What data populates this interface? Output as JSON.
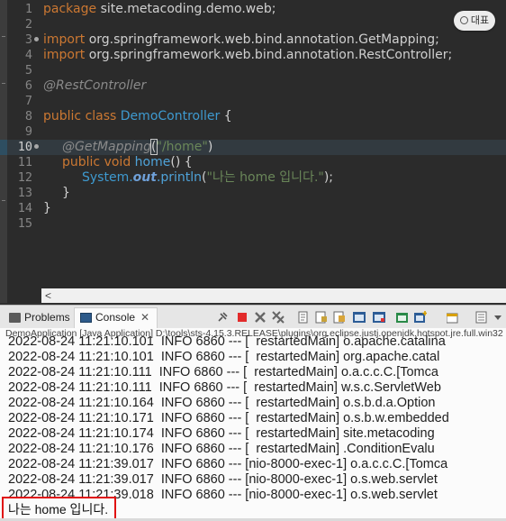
{
  "editor": {
    "translate_button": "대표",
    "line_numbers": [
      "1",
      "2",
      "3",
      "4",
      "5",
      "6",
      "7",
      "8",
      "9",
      "10",
      "11",
      "12",
      "13",
      "14",
      "15"
    ],
    "lines": {
      "l1_kw": "package ",
      "l1_rest": "site.metacoding.demo.web;",
      "l3_kw": "import ",
      "l3_rest": "org.springframework.web.bind.annotation.GetMapping;",
      "l4_kw": "import ",
      "l4_rest": "org.springframework.web.bind.annotation.RestController;",
      "l6_ann": "@RestController",
      "l8_kw": "public class ",
      "l8_type": "DemoController",
      "l8_rest": " {",
      "l10_ann": "@GetMapping",
      "l10_paren": "(",
      "l10_str": "\"/home\"",
      "l10_close": ")",
      "l11_kw": "public void ",
      "l11_mth": "home",
      "l11_rest": "() {",
      "l12_cls": "System.",
      "l12_fld": "out",
      "l12_mth": ".println",
      "l12_paren": "(",
      "l12_str": "\"나는 home 입니다.\"",
      "l12_rest": ");",
      "l13": "}",
      "l14": "}"
    },
    "scroll_arrow": "<"
  },
  "views": {
    "problems_tab": "Problems",
    "console_tab": "Console",
    "close_symbol": "✕",
    "toolbar_icons": [
      "pin-icon",
      "terminate-icon",
      "remove-launch-icon",
      "remove-all-icon",
      "clear-console-icon",
      "scroll-lock-icon",
      "word-wrap-icon",
      "show-on-stdout-icon",
      "show-on-stderr-icon",
      "open-console-icon",
      "new-console-icon",
      "display-selected-icon"
    ]
  },
  "console": {
    "launch_label": "DemoApplication [Java Application] D:\\tools\\sts-4.15.3.RELEASE\\plugins\\org.eclipse.justj.openjdk.hotspot.jre.full.win32",
    "log_lines": [
      "2022-08-24 11:21:10.101  INFO 6860 --- [  restartedMain] o.apache.catalina",
      "2022-08-24 11:21:10.101  INFO 6860 --- [  restartedMain] org.apache.catal",
      "2022-08-24 11:21:10.111  INFO 6860 --- [  restartedMain] o.a.c.c.C.[Tomca",
      "2022-08-24 11:21:10.111  INFO 6860 --- [  restartedMain] w.s.c.ServletWeb",
      "2022-08-24 11:21:10.164  INFO 6860 --- [  restartedMain] o.s.b.d.a.Option",
      "2022-08-24 11:21:10.171  INFO 6860 --- [  restartedMain] o.s.b.w.embedded",
      "2022-08-24 11:21:10.174  INFO 6860 --- [  restartedMain] site.metacoding",
      "2022-08-24 11:21:10.176  INFO 6860 --- [  restartedMain] .ConditionEvalu",
      "2022-08-24 11:21:39.017  INFO 6860 --- [nio-8000-exec-1] o.a.c.c.C.[Tomca",
      "2022-08-24 11:21:39.017  INFO 6860 --- [nio-8000-exec-1] o.s.web.servlet",
      "2022-08-24 11:21:39.018  INFO 6860 --- [nio-8000-exec-1] o.s.web.servlet"
    ],
    "program_output": "나는 home 입니다."
  }
}
